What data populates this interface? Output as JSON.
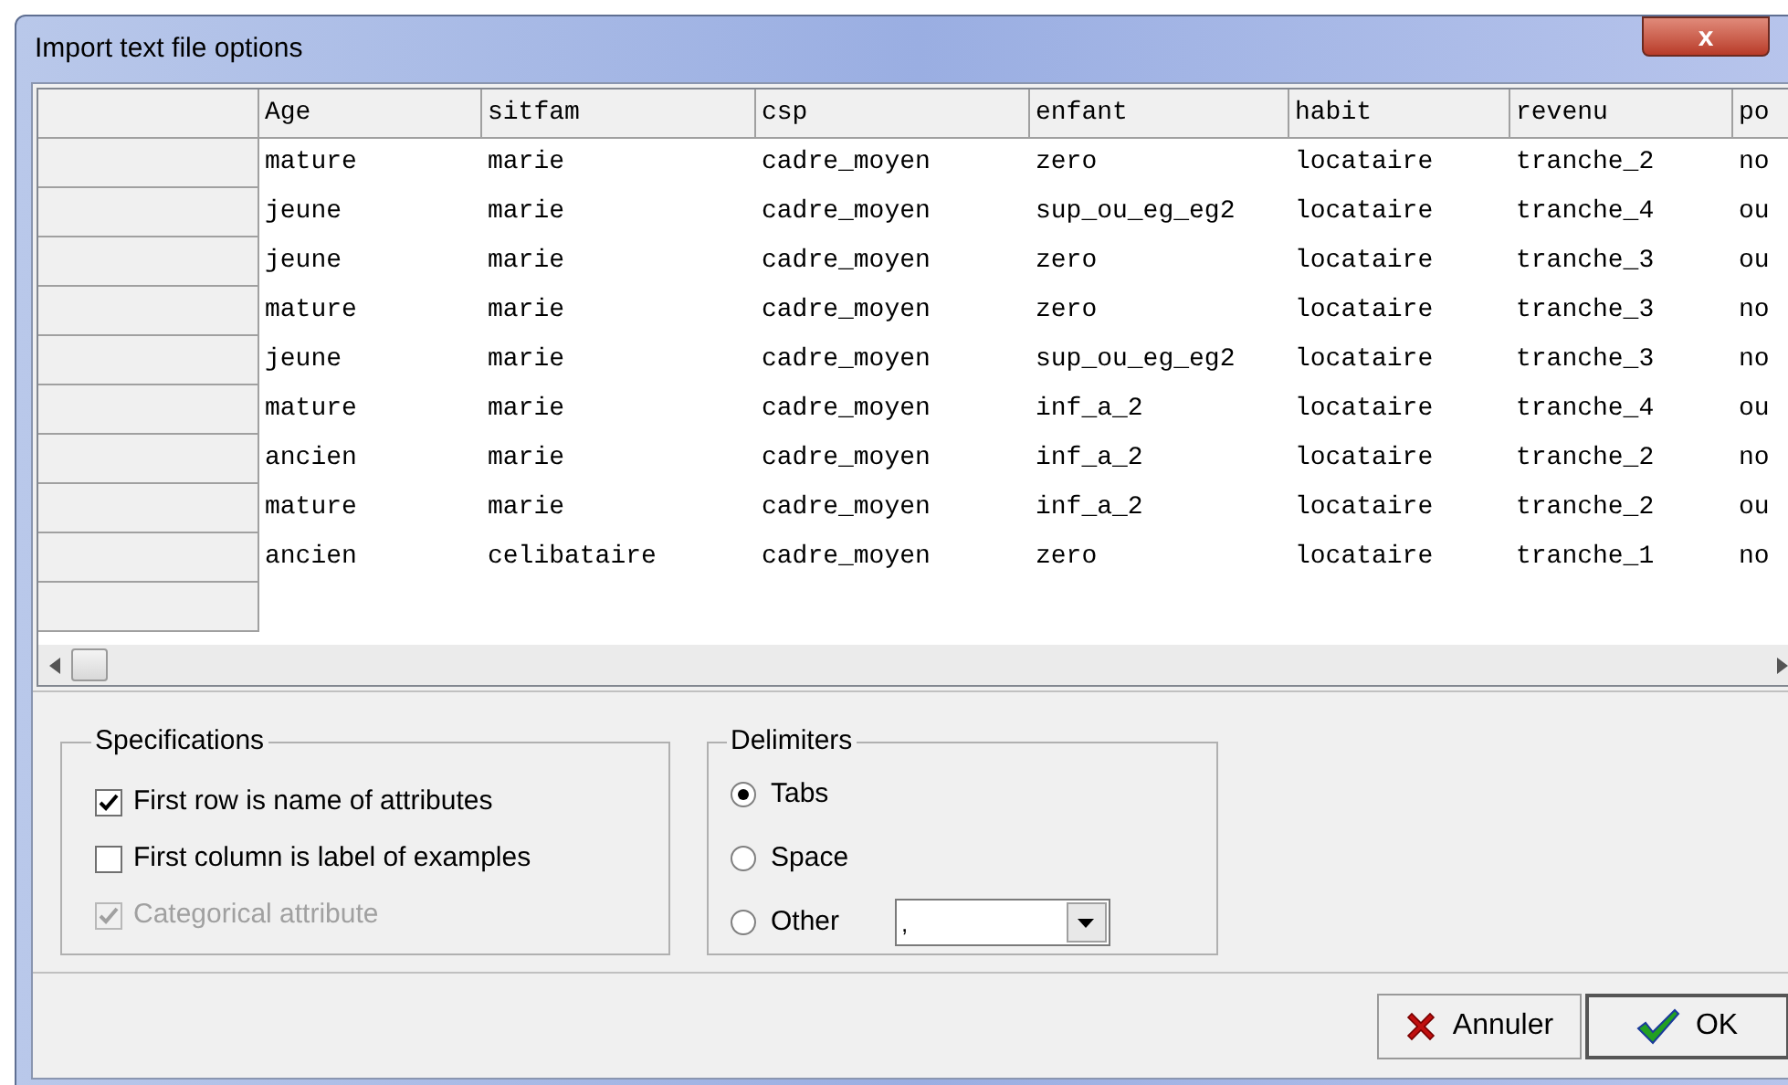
{
  "window": {
    "title": "Import text file options",
    "close_label": "x"
  },
  "table": {
    "columns": [
      "Age",
      "sitfam",
      "csp",
      "enfant",
      "habit",
      "revenu",
      "po"
    ],
    "rows": [
      [
        "mature",
        "marie",
        "cadre_moyen",
        "zero",
        "locataire",
        "tranche_2",
        "no"
      ],
      [
        "jeune",
        "marie",
        "cadre_moyen",
        "sup_ou_eg_eg2",
        "locataire",
        "tranche_4",
        "ou"
      ],
      [
        "jeune",
        "marie",
        "cadre_moyen",
        "zero",
        "locataire",
        "tranche_3",
        "ou"
      ],
      [
        "mature",
        "marie",
        "cadre_moyen",
        "zero",
        "locataire",
        "tranche_3",
        "no"
      ],
      [
        "jeune",
        "marie",
        "cadre_moyen",
        "sup_ou_eg_eg2",
        "locataire",
        "tranche_3",
        "no"
      ],
      [
        "mature",
        "marie",
        "cadre_moyen",
        "inf_a_2",
        "locataire",
        "tranche_4",
        "ou"
      ],
      [
        "ancien",
        "marie",
        "cadre_moyen",
        "inf_a_2",
        "locataire",
        "tranche_2",
        "no"
      ],
      [
        "mature",
        "marie",
        "cadre_moyen",
        "inf_a_2",
        "locataire",
        "tranche_2",
        "ou"
      ],
      [
        "ancien",
        "celibataire",
        "cadre_moyen",
        "zero",
        "locataire",
        "tranche_1",
        "no"
      ]
    ]
  },
  "specifications": {
    "title": "Specifications",
    "options": [
      {
        "label": "First row is name of attributes",
        "checked": true,
        "disabled": false
      },
      {
        "label": "First column is label of examples",
        "checked": false,
        "disabled": false
      },
      {
        "label": "Categorical attribute",
        "checked": true,
        "disabled": true
      }
    ]
  },
  "delimiters": {
    "title": "Delimiters",
    "options": [
      {
        "label": "Tabs",
        "selected": true
      },
      {
        "label": "Space",
        "selected": false
      },
      {
        "label": "Other",
        "selected": false
      }
    ],
    "other_value": ","
  },
  "buttons": [
    {
      "kind": "cancel",
      "label": "Annuler"
    },
    {
      "kind": "ok",
      "label": "OK"
    }
  ]
}
